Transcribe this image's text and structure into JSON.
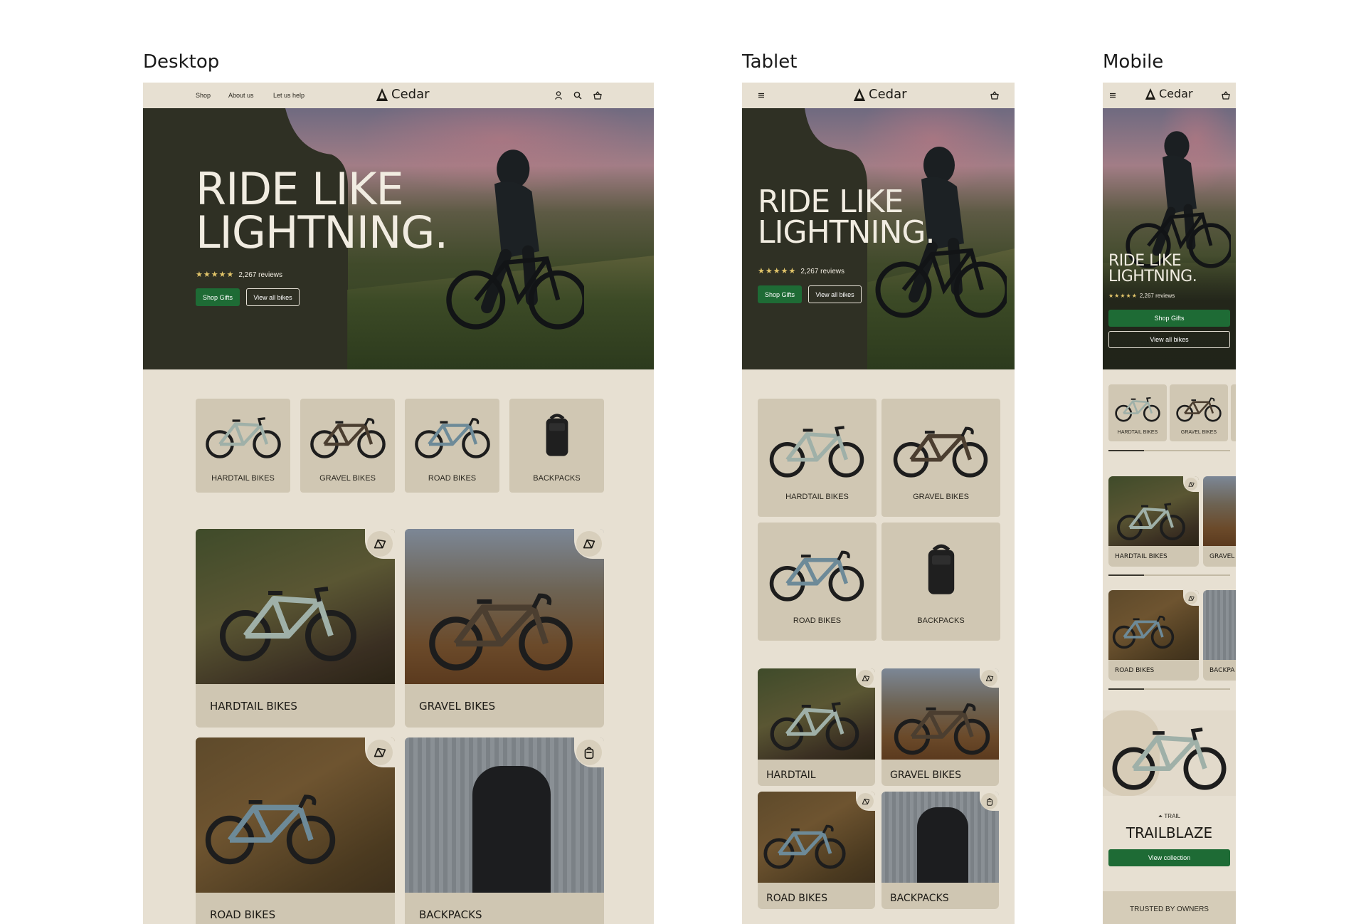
{
  "labels": {
    "desktop": "Desktop",
    "tablet": "Tablet",
    "mobile": "Mobile"
  },
  "brand": {
    "name": "Cedar"
  },
  "desktop": {
    "nav": [
      "Shop",
      "About us",
      "Let us help"
    ],
    "hero": {
      "line1": "RIDE LIKE",
      "line2": "LIGHTNING.",
      "stars": "★★★★★",
      "reviews": "2,267 reviews",
      "cta_primary": "Shop Gifts",
      "cta_secondary": "View all bikes"
    },
    "categories": [
      "HARDTAIL BIKES",
      "GRAVEL BIKES",
      "ROAD BIKES",
      "BACKPACKS"
    ],
    "cards": [
      "HARDTAIL BIKES",
      "GRAVEL BIKES",
      "ROAD BIKES",
      "BACKPACKS"
    ]
  },
  "tablet": {
    "hero": {
      "line1": "RIDE LIKE",
      "line2": "LIGHTNING.",
      "stars": "★★★★★",
      "reviews": "2,267 reviews",
      "cta_primary": "Shop Gifts",
      "cta_secondary": "View all bikes"
    },
    "categories": [
      "HARDTAIL BIKES",
      "GRAVEL BIKES",
      "ROAD BIKES",
      "BACKPACKS"
    ],
    "cards": [
      "HARDTAIL",
      "GRAVEL BIKES",
      "ROAD BIKES",
      "BACKPACKS"
    ]
  },
  "mobile": {
    "hero": {
      "line1": "RIDE LIKE",
      "line2": "LIGHTNING.",
      "stars": "★★★★★",
      "reviews": "2,267 reviews",
      "cta_primary": "Shop Gifts",
      "cta_secondary": "View all bikes"
    },
    "categories": [
      "HARDTAIL BIKES",
      "GRAVEL BIKES"
    ],
    "cards_row1": [
      "HARDTAIL BIKES",
      "GRAVEL"
    ],
    "cards_row2": [
      "ROAD BIKES",
      "BACKPA"
    ],
    "feature": {
      "tag": "TRAIL",
      "title": "TRAILBLAZE",
      "cta": "View collection"
    },
    "footer_teaser": "TRUSTED BY OWNERS"
  },
  "colors": {
    "accent": "#1e6b35",
    "background": "#e7e0d2",
    "card": "#cfc6b2",
    "star": "#e2c56a"
  }
}
